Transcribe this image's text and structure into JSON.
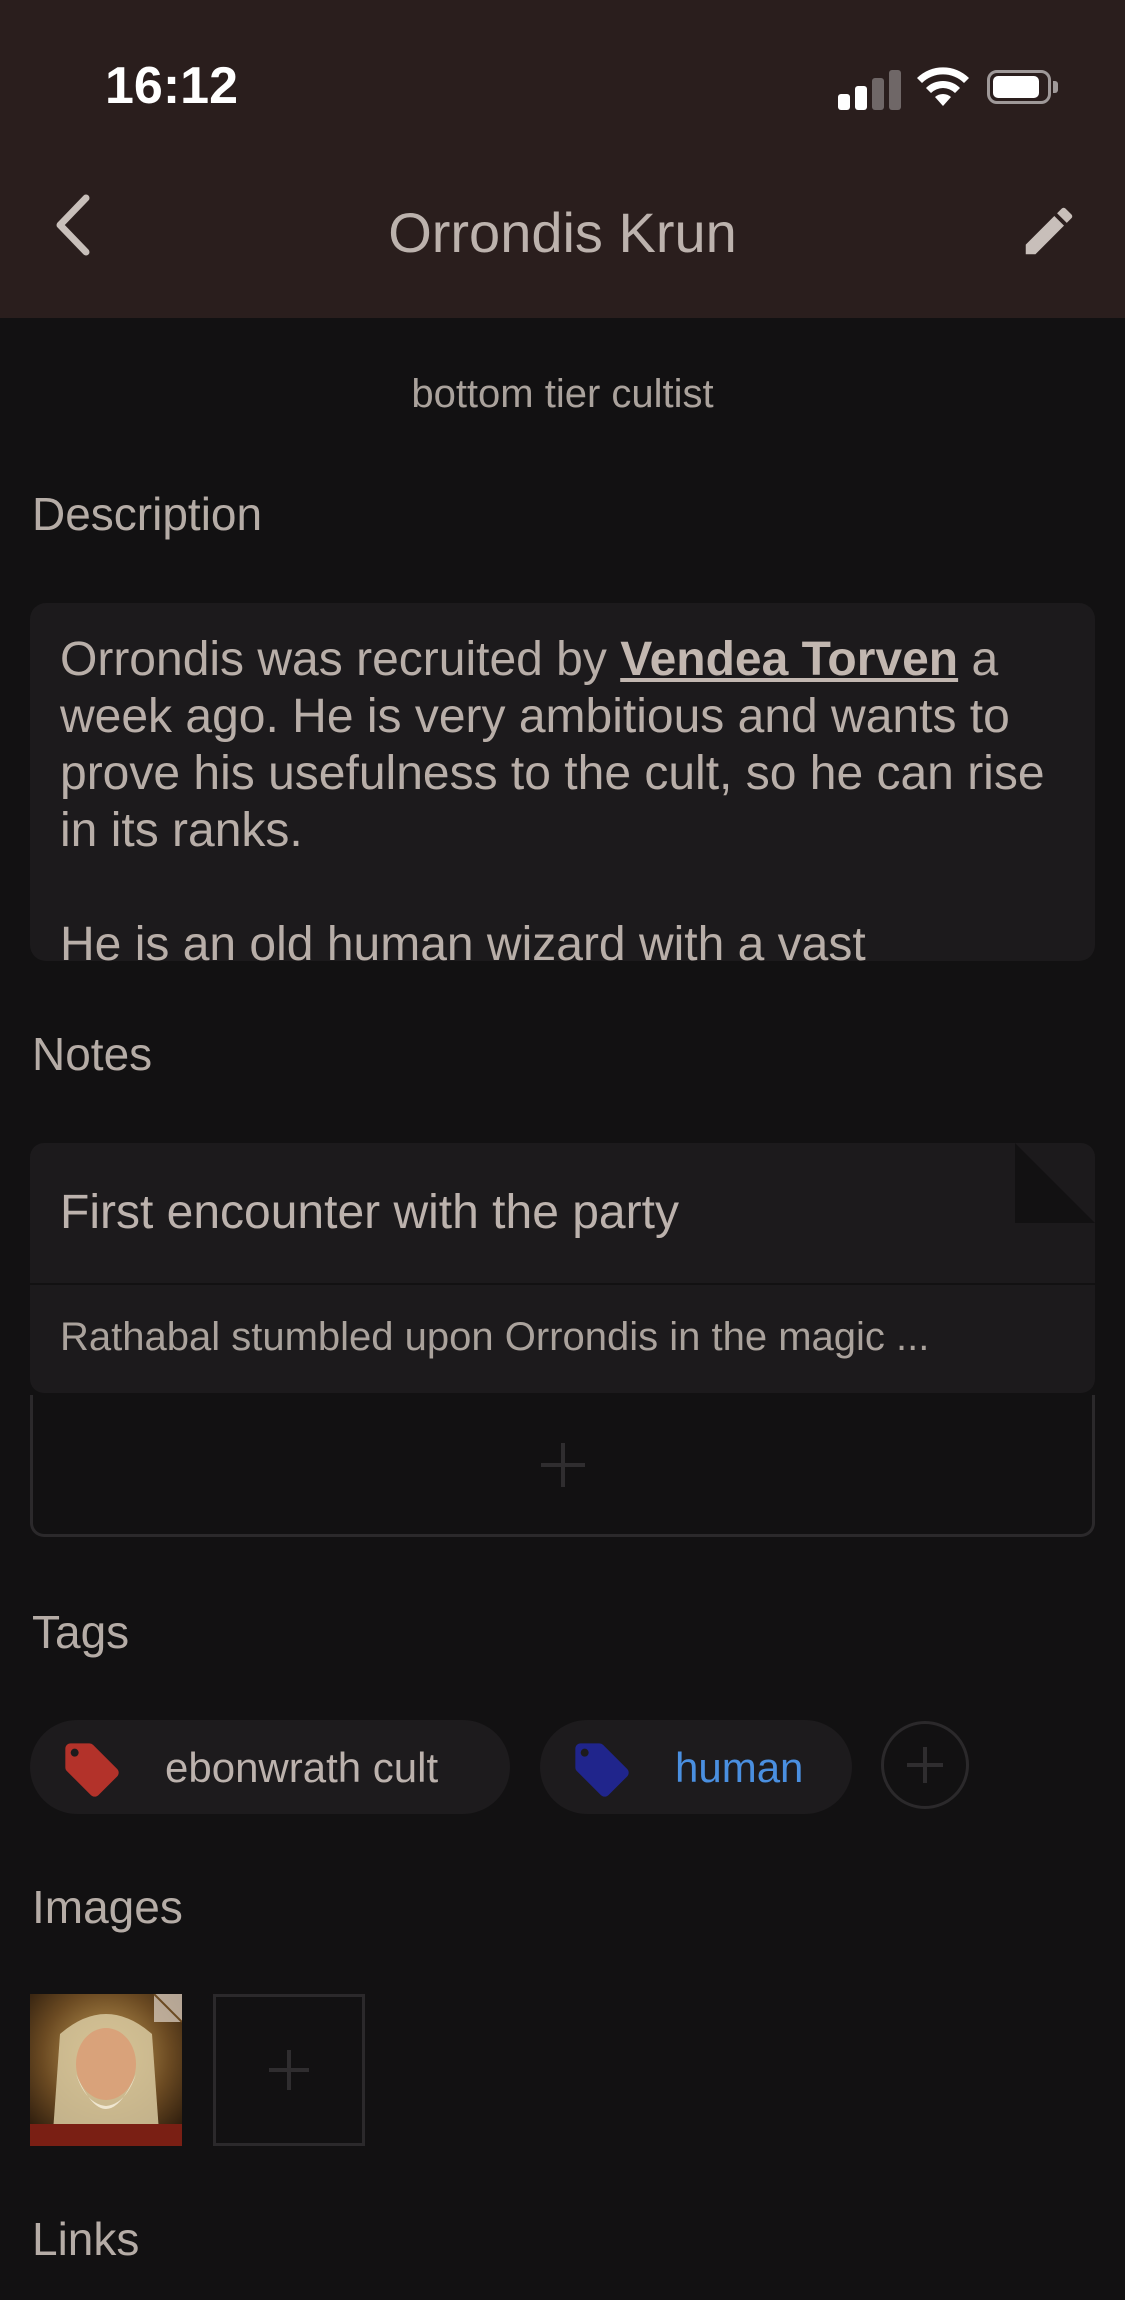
{
  "status_bar": {
    "time": "16:12"
  },
  "header": {
    "title": "Orrondis Krun"
  },
  "subtitle": "bottom tier cultist",
  "description": {
    "heading": "Description",
    "text_before_link": "Orrondis was recruited by ",
    "link_text": "Vendea Torven",
    "text_after_link": " a week ago. He is very ambitious and wants to prove his usefulness to the cult, so he can rise in its ranks.",
    "second_paragraph": "He is an old human wizard with a vast"
  },
  "notes": {
    "heading": "Notes",
    "items": [
      {
        "title": "First encounter with the party",
        "preview": "Rathabal stumbled upon Orrondis in the magic ..."
      }
    ]
  },
  "tags": {
    "heading": "Tags",
    "items": [
      {
        "label": "ebonwrath cult",
        "color": "#b3322a",
        "label_color": "#bcb2ad"
      },
      {
        "label": "human",
        "color": "#20258c",
        "label_color": "#4a8fe0"
      }
    ]
  },
  "images": {
    "heading": "Images"
  },
  "links": {
    "heading": "Links"
  }
}
